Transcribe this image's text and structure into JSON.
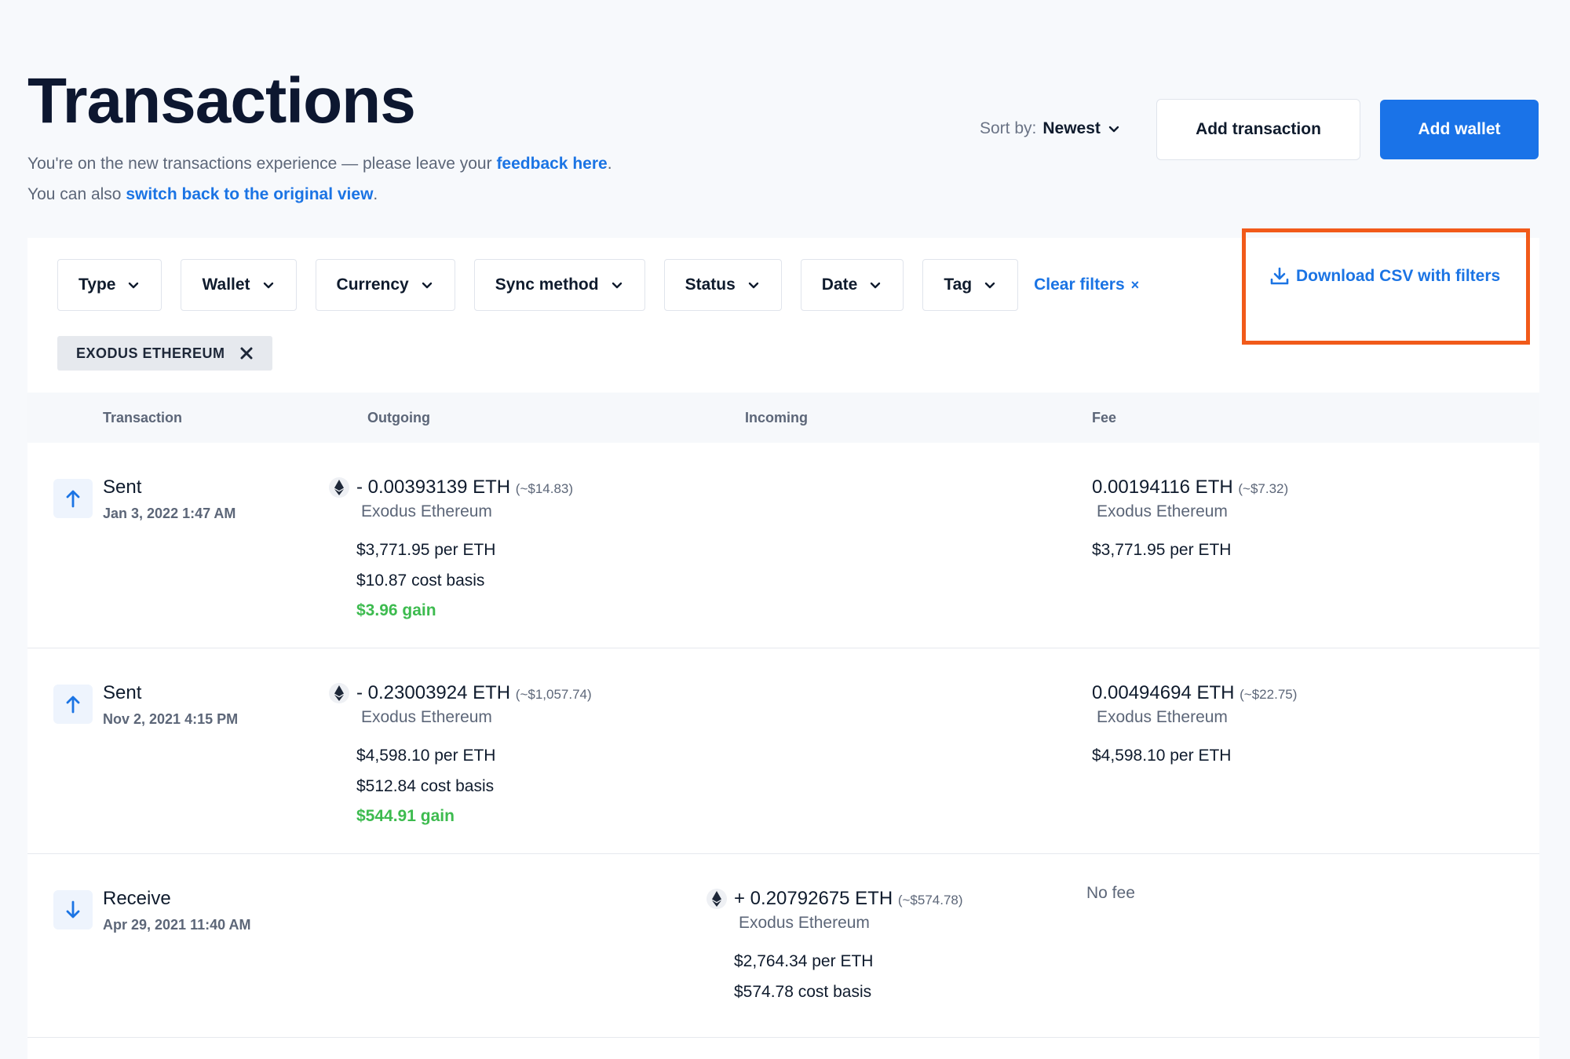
{
  "header": {
    "title": "Transactions",
    "notice_prefix": "You're on the new transactions experience — please leave your ",
    "feedback_link": "feedback here",
    "notice_suffix": ".",
    "switch_prefix": "You can also ",
    "switch_link": "switch back to the original view",
    "switch_suffix": "."
  },
  "toolbar": {
    "sort_label": "Sort by:",
    "sort_value": "Newest",
    "add_transaction": "Add transaction",
    "add_wallet": "Add wallet"
  },
  "filters": {
    "items": [
      "Type",
      "Wallet",
      "Currency",
      "Sync method",
      "Status",
      "Date",
      "Tag"
    ],
    "clear": "Clear filters",
    "clear_x": "×",
    "download_csv": "Download CSV with filters",
    "active_chip": "EXODUS ETHEREUM"
  },
  "table": {
    "columns": [
      "Transaction",
      "Outgoing",
      "Incoming",
      "Fee"
    ],
    "rows": [
      {
        "type": "Sent",
        "direction": "up",
        "date": "Jan 3, 2022 1:47 AM",
        "outgoing": {
          "amount": "- 0.00393139 ETH",
          "usd": "(~$14.83)",
          "wallet": "Exodus Ethereum",
          "price": "$3,771.95 per ETH",
          "cost_basis": "$10.87 cost basis",
          "gain": "$3.96 gain"
        },
        "fee": {
          "amount": "0.00194116 ETH",
          "usd": "(~$7.32)",
          "wallet": "Exodus Ethereum",
          "price": "$3,771.95 per ETH"
        }
      },
      {
        "type": "Sent",
        "direction": "up",
        "date": "Nov 2, 2021 4:15 PM",
        "outgoing": {
          "amount": "- 0.23003924 ETH",
          "usd": "(~$1,057.74)",
          "wallet": "Exodus Ethereum",
          "price": "$4,598.10 per ETH",
          "cost_basis": "$512.84 cost basis",
          "gain": "$544.91 gain"
        },
        "fee": {
          "amount": "0.00494694 ETH",
          "usd": "(~$22.75)",
          "wallet": "Exodus Ethereum",
          "price": "$4,598.10 per ETH"
        }
      },
      {
        "type": "Receive",
        "direction": "down",
        "date": "Apr 29, 2021 11:40 AM",
        "incoming": {
          "amount": "+ 0.20792675 ETH",
          "usd": "(~$574.78)",
          "wallet": "Exodus Ethereum",
          "price": "$2,764.34 per ETH",
          "cost_basis": "$574.78 cost basis"
        },
        "fee": {
          "none": "No fee"
        }
      }
    ]
  },
  "colors": {
    "accent": "#1a73e8",
    "link": "#1b74e4",
    "gain": "#3dbb4f",
    "highlight": "#f15a1a"
  }
}
